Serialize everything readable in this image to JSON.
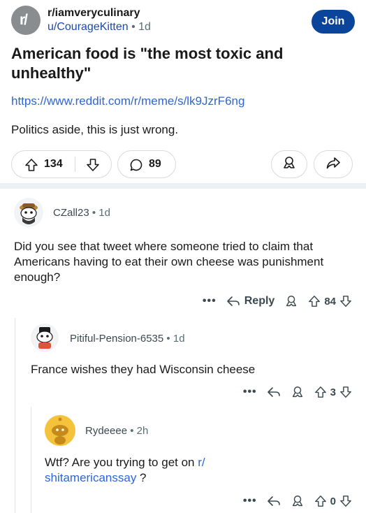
{
  "post": {
    "subreddit": "r/iamveryculinary",
    "author": "u/CourageKitten",
    "separator": "•",
    "age": "1d",
    "join_label": "Join",
    "title": "American food is \"the most toxic and unhealthy\"",
    "link": "https://www.reddit.com/r/meme/s/lk9JzrF6ng",
    "body": "Politics aside, this is just wrong.",
    "upvotes": "134",
    "comments": "89"
  },
  "comments": [
    {
      "author": "CZall23",
      "age": "1d",
      "text": "Did you see that tweet where someone tried to claim that Americans having to eat their own cheese was punishment enough?",
      "reply_label": "Reply",
      "score": "84"
    },
    {
      "author": "Pitiful-Pension-6535",
      "age": "1d",
      "text": "France wishes they had Wisconsin cheese",
      "score": "3"
    },
    {
      "author": "Rydeeee",
      "age": "2h",
      "text_before": "Wtf? Are you trying to get on ",
      "link_1": "r/",
      "link_2": "shitamericanssay",
      "text_after": " ?",
      "score": "0"
    }
  ],
  "ui": {
    "more_dots": "•••",
    "separator": "•"
  },
  "colors": {
    "accent": "#0a449b",
    "link": "#2d66d8",
    "muted": "#576f76",
    "divider": "#eef1f3"
  }
}
